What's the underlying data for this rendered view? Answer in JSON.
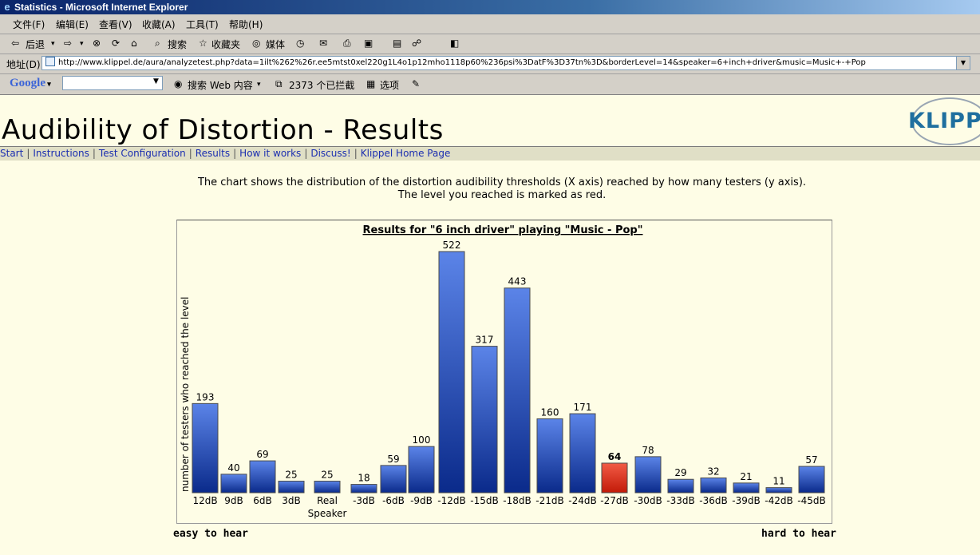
{
  "window": {
    "title": "Statistics - Microsoft Internet Explorer"
  },
  "menu": [
    "文件(F)",
    "编辑(E)",
    "查看(V)",
    "收藏(A)",
    "工具(T)",
    "帮助(H)"
  ],
  "toolbar": {
    "back": "后退",
    "search": "搜索",
    "favorites": "收藏夹",
    "media": "媒体"
  },
  "address": {
    "label": "地址(D)",
    "url": "http://www.klippel.de/aura/analyzetest.php?data=1ilt%262%26r.ee5mtst0xel220g1L4o1p12mho1118p60%236psi%3DatF%3D37tn%3D&borderLevel=14&speaker=6+inch+driver&music=Music+-+Pop"
  },
  "googlebar": {
    "logo": "Google",
    "search_web": "搜索 Web 内容",
    "blocked": "2373 个已拦截",
    "options": "选项"
  },
  "page": {
    "title": "Audibility of Distortion - Results",
    "logo_text": "KLIPPE",
    "nav": [
      "Start",
      "Instructions",
      "Test Configuration",
      "Results",
      "How it works",
      "Discuss!",
      "Klippel Home Page"
    ],
    "intro_line1": "The chart shows the distribution of the distortion audibility thresholds (X axis) reached by how many testers (y axis).",
    "intro_line2": "The level you reached is marked as red.",
    "easy": "easy to hear",
    "hard": "hard to hear"
  },
  "colors": {
    "bar_top": "#5b84e8",
    "bar_bottom": "#0a2a8a",
    "highlight_top": "#f25b45",
    "highlight_bottom": "#c21a08",
    "page_bg": "#fefde6"
  },
  "chart_data": {
    "type": "bar",
    "title": "Results for \"6 inch driver\" playing \"Music - Pop\"",
    "xlabel": "",
    "ylabel": "number of testers who reached the level",
    "categories": [
      "12dB",
      "9dB",
      "6dB",
      "3dB",
      "Real Speaker",
      "-3dB",
      "-6dB",
      "-9dB",
      "-12dB",
      "-15dB",
      "-18dB",
      "-21dB",
      "-24dB",
      "-27dB",
      "-30dB",
      "-33dB",
      "-36dB",
      "-39dB",
      "-42dB",
      "-45dB"
    ],
    "values": [
      193,
      40,
      69,
      25,
      25,
      18,
      59,
      100,
      522,
      317,
      443,
      160,
      171,
      64,
      78,
      29,
      32,
      21,
      11,
      57
    ],
    "highlighted": "-27dB",
    "grid": false
  }
}
